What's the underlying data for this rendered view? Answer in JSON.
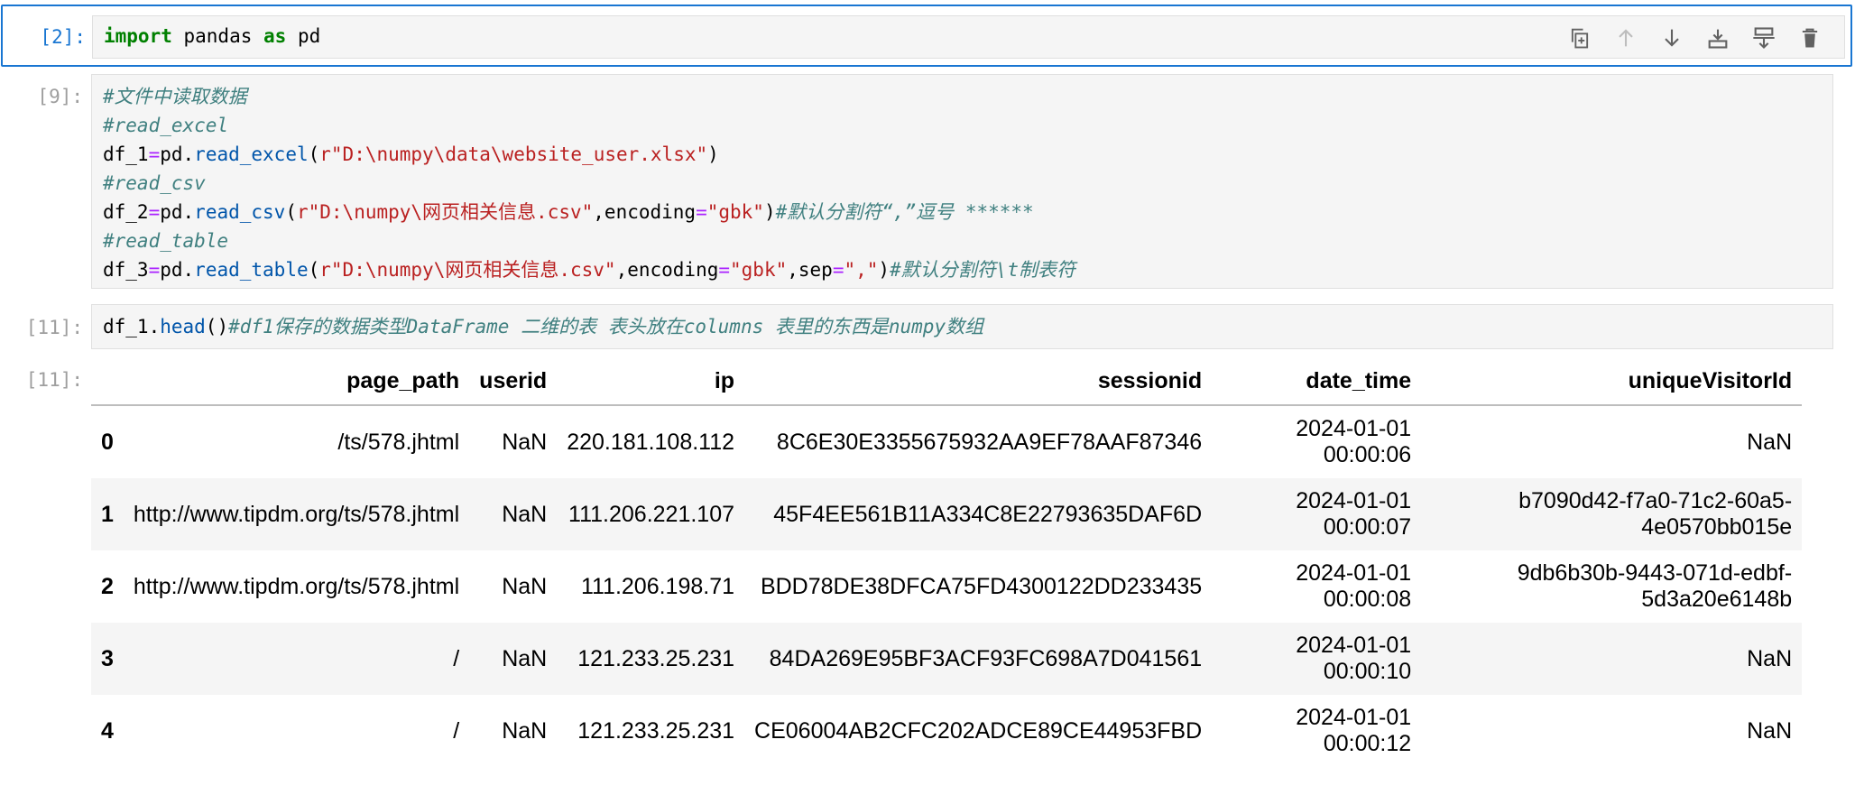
{
  "cells": {
    "c2": {
      "prompt": "[2]:",
      "code": {
        "t1": "import",
        "t2": " pandas ",
        "t3": "as",
        "t4": " pd"
      }
    },
    "c9": {
      "prompt": "[9]:",
      "l1": "#文件中读取数据",
      "l2": "#read_excel",
      "l3": {
        "a": "df_1",
        "b": "=",
        "c": "pd.",
        "d": "read_excel",
        "e": "(",
        "f": "r\"D:\\numpy\\data\\website_user.xlsx\"",
        "g": ")"
      },
      "l4": "#read_csv",
      "l5": {
        "a": "df_2",
        "b": "=",
        "c": "pd.",
        "d": "read_csv",
        "e": "(",
        "f": "r\"D:\\numpy\\网页相关信息.csv\"",
        "g": ",encoding",
        "h": "=",
        "i": "\"gbk\"",
        "j": ")",
        "k": "#默认分割符“,”逗号 ******"
      },
      "l6": "#read_table",
      "l7": {
        "a": "df_3",
        "b": "=",
        "c": "pd.",
        "d": "read_table",
        "e": "(",
        "f": "r\"D:\\numpy\\网页相关信息.csv\"",
        "g": ",encoding",
        "h": "=",
        "i": "\"gbk\"",
        "j": ",sep",
        "k": "=",
        "l": "\",\"",
        "m": ")",
        "n": "#默认分割符\\t制表符"
      }
    },
    "c11": {
      "prompt": "[11]:",
      "code": {
        "a": "df_1.",
        "b": "head",
        "c": "()",
        "d": "#df1保存的数据类型DataFrame 二维的表 表头放在columns 表里的东西是numpy数组"
      },
      "out_prompt": "[11]:"
    }
  },
  "toolbar": [
    "copy-icon",
    "move-up-icon",
    "move-down-icon",
    "insert-below-icon",
    "insert-above-icon",
    "delete-icon"
  ],
  "table": {
    "columns": [
      "",
      "page_path",
      "userid",
      "ip",
      "sessionid",
      "date_time",
      "uniqueVisitorId"
    ],
    "rows": [
      {
        "idx": "0",
        "page_path": "/ts/578.jhtml",
        "userid": "NaN",
        "ip": "220.181.108.112",
        "sessionid": "8C6E30E3355675932AA9EF78AAF87346",
        "date": "2024-01-01",
        "time": "00:00:06",
        "uv1": "NaN",
        "uv2": ""
      },
      {
        "idx": "1",
        "page_path": "http://www.tipdm.org/ts/578.jhtml",
        "userid": "NaN",
        "ip": "111.206.221.107",
        "sessionid": "45F4EE561B11A334C8E22793635DAF6D",
        "date": "2024-01-01",
        "time": "00:00:07",
        "uv1": "b7090d42-f7a0-71c2-60a5-",
        "uv2": "4e0570bb015e"
      },
      {
        "idx": "2",
        "page_path": "http://www.tipdm.org/ts/578.jhtml",
        "userid": "NaN",
        "ip": "111.206.198.71",
        "sessionid": "BDD78DE38DFCA75FD4300122DD233435",
        "date": "2024-01-01",
        "time": "00:00:08",
        "uv1": "9db6b30b-9443-071d-edbf-",
        "uv2": "5d3a20e6148b"
      },
      {
        "idx": "3",
        "page_path": "/",
        "userid": "NaN",
        "ip": "121.233.25.231",
        "sessionid": "84DA269E95BF3ACF93FC698A7D041561",
        "date": "2024-01-01",
        "time": "00:00:10",
        "uv1": "NaN",
        "uv2": ""
      },
      {
        "idx": "4",
        "page_path": "/",
        "userid": "NaN",
        "ip": "121.233.25.231",
        "sessionid": "CE06004AB2CFC202ADCE89CE44953FBD",
        "date": "2024-01-01",
        "time": "00:00:12",
        "uv1": "NaN",
        "uv2": ""
      }
    ]
  }
}
